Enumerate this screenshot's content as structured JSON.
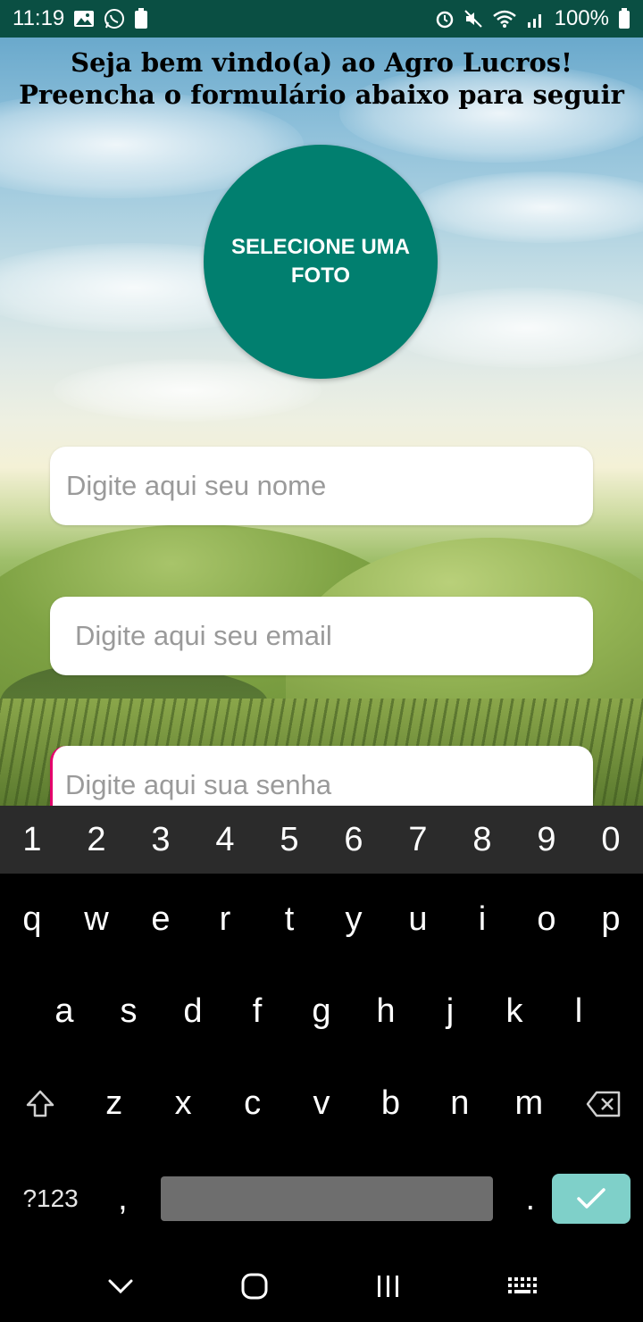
{
  "status_bar": {
    "time": "11:19",
    "battery": "100%",
    "icons_left": [
      "gallery-icon",
      "whatsapp-icon",
      "battery-saver-icon"
    ],
    "icons_right": [
      "alarm-icon",
      "mute-icon",
      "wifi-icon",
      "signal-icon",
      "battery-icon"
    ]
  },
  "header": {
    "line1": "Seja bem vindo(a) ao Agro Lucros!",
    "line2": "Preencha o formulário abaixo para seguir"
  },
  "photo_button": {
    "label": "SELECIONE UMA FOTO",
    "color": "#017f6f"
  },
  "form": {
    "name": {
      "value": "",
      "placeholder": "Digite aqui seu nome"
    },
    "email": {
      "value": "",
      "placeholder": "Digite aqui seu email"
    },
    "password": {
      "value": "",
      "placeholder": "Digite aqui sua senha"
    }
  },
  "keyboard": {
    "numbers": [
      "1",
      "2",
      "3",
      "4",
      "5",
      "6",
      "7",
      "8",
      "9",
      "0"
    ],
    "row1": [
      "q",
      "w",
      "e",
      "r",
      "t",
      "y",
      "u",
      "i",
      "o",
      "p"
    ],
    "row2": [
      "a",
      "s",
      "d",
      "f",
      "g",
      "h",
      "j",
      "k",
      "l"
    ],
    "row3": [
      "z",
      "x",
      "c",
      "v",
      "b",
      "n",
      "m"
    ],
    "symbols_label": "?123",
    "comma": ",",
    "period": ".",
    "enter_color": "#7fd0c9"
  },
  "navbar": {
    "icons": [
      "back-chevron-icon",
      "home-icon",
      "recents-icon",
      "keyboard-icon"
    ]
  }
}
